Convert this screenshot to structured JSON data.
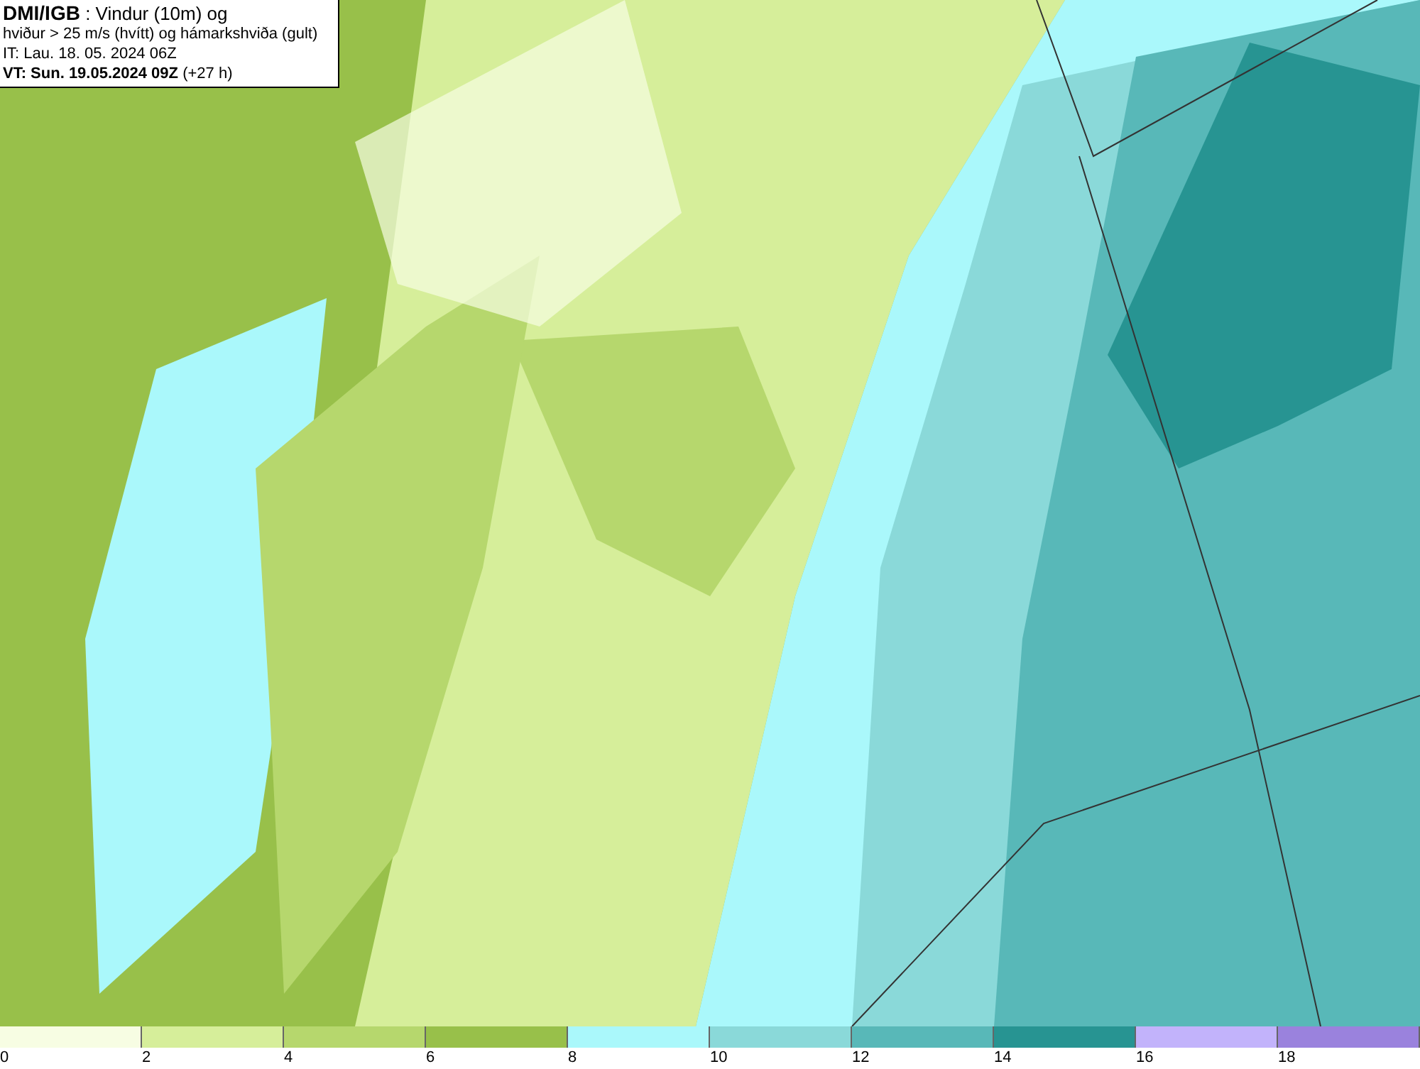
{
  "title_box": {
    "lines": [
      "**DMI/IGB** : Vindur (10m) og",
      "hviður > 25 m/s (hvítt) og hámarkshviða (gult)",
      "IT: Lau. 18. 05. 2024 06Z",
      "**VT: Sun. 19.05.2024 09Z** (+27 h)"
    ]
  },
  "legend": [
    {
      "label": "0",
      "color": "#f7fde3"
    },
    {
      "label": "2",
      "color": "#d6ee9a"
    },
    {
      "label": "4",
      "color": "#b6d76d"
    },
    {
      "label": "6",
      "color": "#98c04a"
    },
    {
      "label": "8",
      "color": "#aaf8fb"
    },
    {
      "label": "10",
      "color": "#8ad9d9"
    },
    {
      "label": "12",
      "color": "#58b8b8"
    },
    {
      "label": "14",
      "color": "#279492"
    },
    {
      "label": "16",
      "color": "#c2b3fb"
    },
    {
      "label": "18",
      "color": "#9a82dd"
    }
  ]
}
